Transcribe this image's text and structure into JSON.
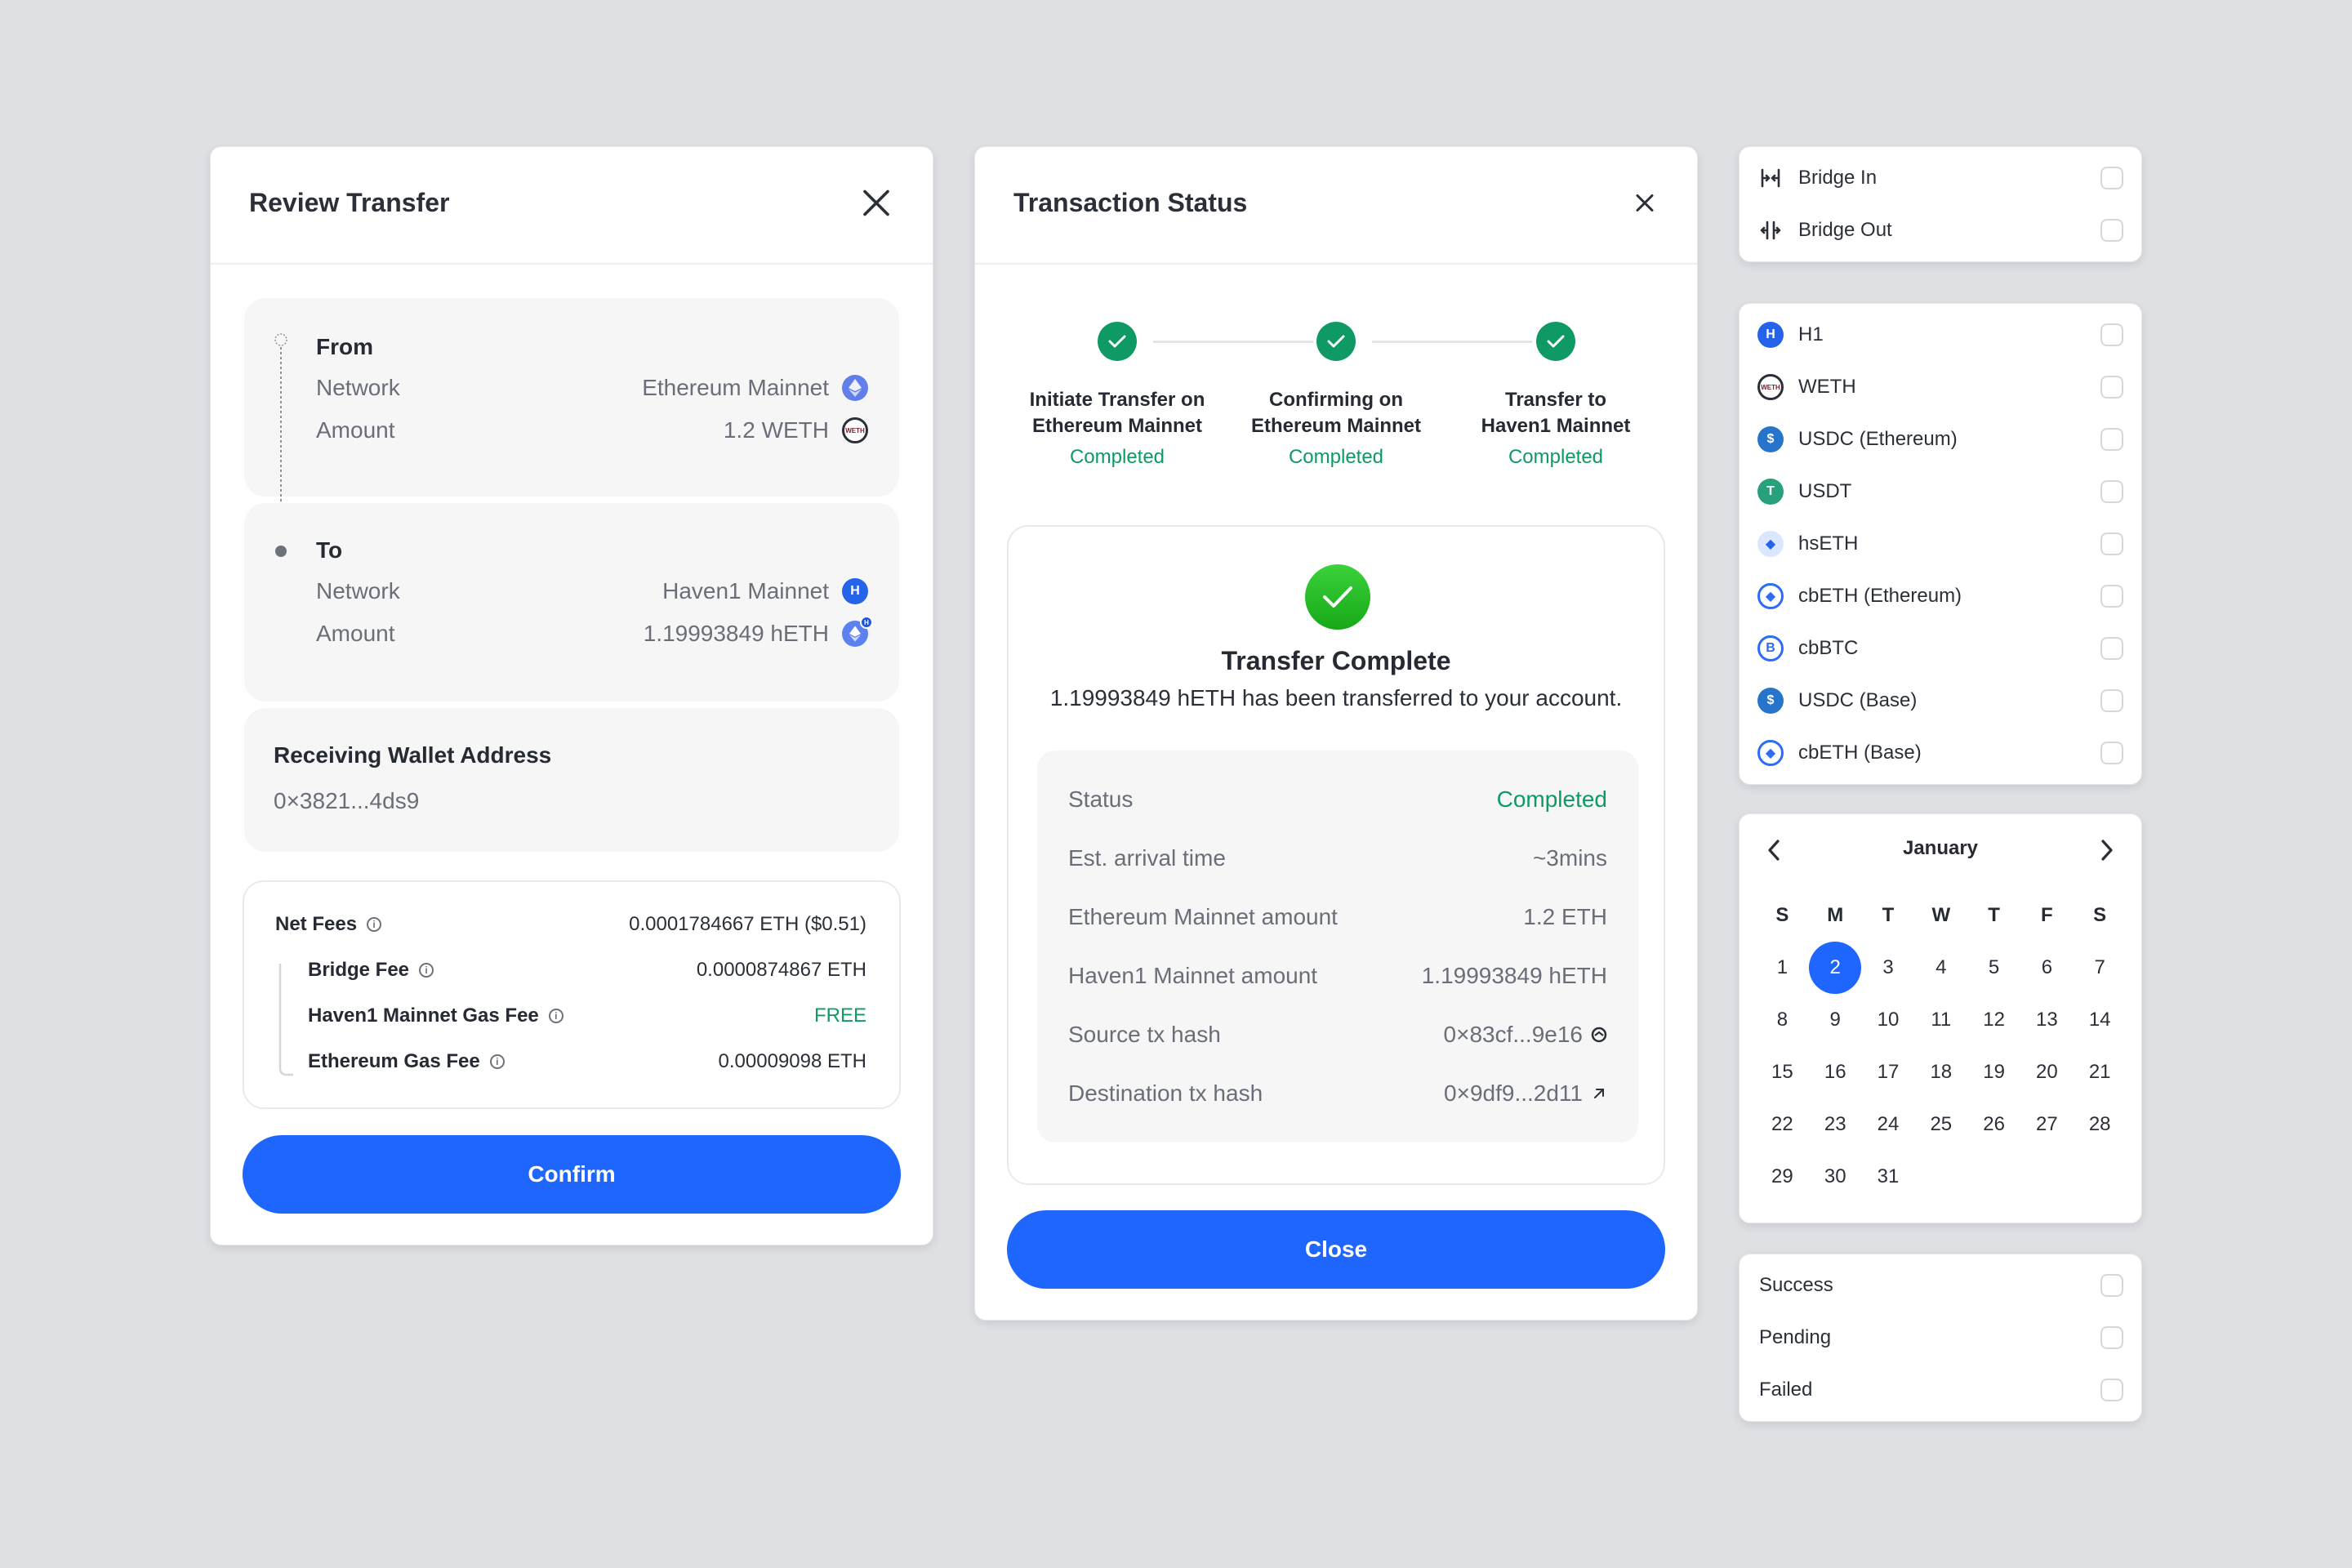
{
  "review": {
    "title": "Review Transfer",
    "from": {
      "heading": "From",
      "network_label": "Network",
      "network_value": "Ethereum Mainnet",
      "network_icon": "ethereum-icon",
      "amount_label": "Amount",
      "amount_value": "1.2 WETH",
      "amount_icon": "weth-icon"
    },
    "to": {
      "heading": "To",
      "network_label": "Network",
      "network_value": "Haven1 Mainnet",
      "network_icon": "haven1-icon",
      "amount_label": "Amount",
      "amount_value": "1.19993849 hETH",
      "amount_icon": "heth-icon"
    },
    "wallet": {
      "heading": "Receiving Wallet Address",
      "address": "0×3821...4ds9"
    },
    "fees": {
      "net_label": "Net Fees",
      "net_value": "0.0001784667 ETH ($0.51)",
      "items": [
        {
          "label": "Bridge Fee",
          "value": "0.0000874867 ETH"
        },
        {
          "label": "Haven1 Mainnet Gas Fee",
          "value": "FREE"
        },
        {
          "label": "Ethereum Gas Fee",
          "value": "0.00009098 ETH"
        }
      ]
    },
    "confirm_label": "Confirm"
  },
  "status": {
    "title": "Transaction Status",
    "steps": [
      {
        "line1": "Initiate Transfer on",
        "line2": "Ethereum Mainnet",
        "status": "Completed"
      },
      {
        "line1": "Confirming on",
        "line2": "Ethereum Mainnet",
        "status": "Completed"
      },
      {
        "line1": "Transfer to",
        "line2": "Haven1 Mainnet",
        "status": "Completed"
      }
    ],
    "complete_title": "Transfer Complete",
    "complete_message": "1.19993849 hETH has been transferred to your account.",
    "rows": [
      {
        "label": "Status",
        "value": "Completed"
      },
      {
        "label": "Est. arrival time",
        "value": "~3mins"
      },
      {
        "label": "Ethereum Mainnet amount",
        "value": "1.2 ETH"
      },
      {
        "label": "Haven1 Mainnet amount",
        "value": "1.19993849 hETH"
      },
      {
        "label": "Source tx hash",
        "value": "0×83cf...9e16"
      },
      {
        "label": "Destination tx hash",
        "value": "0×9df9...2d11"
      }
    ],
    "close_label": "Close"
  },
  "direction_filter": [
    {
      "label": "Bridge In",
      "icon": "bridge-in-icon"
    },
    {
      "label": "Bridge Out",
      "icon": "bridge-out-icon"
    }
  ],
  "token_filter": [
    {
      "label": "H1",
      "icon": "h1-icon"
    },
    {
      "label": "WETH",
      "icon": "weth-icon"
    },
    {
      "label": "USDC (Ethereum)",
      "icon": "usdc-ethereum-icon"
    },
    {
      "label": "USDT",
      "icon": "usdt-icon"
    },
    {
      "label": "hsETH",
      "icon": "hseth-icon"
    },
    {
      "label": "cbETH (Ethereum)",
      "icon": "cbeth-ethereum-icon"
    },
    {
      "label": "cbBTC",
      "icon": "cbbtc-icon"
    },
    {
      "label": "USDC (Base)",
      "icon": "usdc-base-icon"
    },
    {
      "label": "cbETH (Base)",
      "icon": "cbeth-base-icon"
    }
  ],
  "calendar": {
    "month": "January",
    "weekdays": [
      "S",
      "M",
      "T",
      "W",
      "T",
      "F",
      "S"
    ],
    "selected_day": 2,
    "days": [
      "1",
      "2",
      "3",
      "4",
      "5",
      "6",
      "7",
      "8",
      "9",
      "10",
      "11",
      "12",
      "13",
      "14",
      "15",
      "16",
      "17",
      "18",
      "19",
      "20",
      "21",
      "22",
      "23",
      "24",
      "25",
      "26",
      "27",
      "28",
      "29",
      "30",
      "31"
    ]
  },
  "status_filter": [
    {
      "label": "Success"
    },
    {
      "label": "Pending"
    },
    {
      "label": "Failed"
    }
  ],
  "colors": {
    "primary": "#1f66ff",
    "success": "#0e9a63",
    "page_bg": "#dfe0e4"
  }
}
